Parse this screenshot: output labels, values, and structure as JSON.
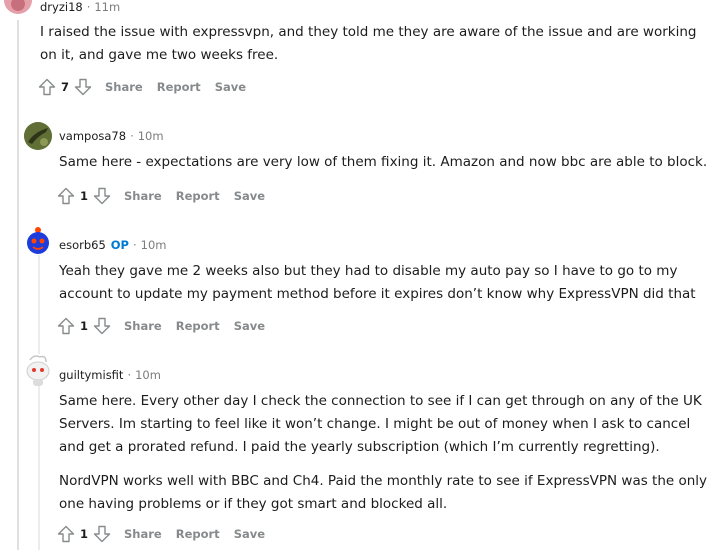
{
  "comments": [
    {
      "username": "dryzi18",
      "time": "11m",
      "body": [
        "I raised the issue with expressvpn, and they told me they are aware of the issue and are working on it, and gave me two weeks free."
      ],
      "score": "7",
      "actions": {
        "share": "Share",
        "report": "Report",
        "save": "Save"
      }
    },
    {
      "username": "vamposa78",
      "time": "10m",
      "body": [
        "Same here - expectations are very low of them fixing it. Amazon and now bbc are able to block."
      ],
      "score": "1",
      "actions": {
        "share": "Share",
        "report": "Report",
        "save": "Save"
      }
    },
    {
      "username": "esorb65",
      "op": "OP",
      "time": "10m",
      "body": [
        "Yeah they gave me 2 weeks also but they had to disable my auto pay so I have to go to my account to update my payment method before it expires don’t know why ExpressVPN did that"
      ],
      "score": "1",
      "actions": {
        "share": "Share",
        "report": "Report",
        "save": "Save"
      }
    },
    {
      "username": "guiltymisfit",
      "time": "10m",
      "body": [
        "Same here. Every other day I check the connection to see if I can get through on any of the UK Servers. Im starting to feel like it won’t change. I might be out of money when I ask to cancel and get a prorated refund. I paid the yearly subscription (which I’m currently regretting).",
        "NordVPN works well with BBC and Ch4. Paid the monthly rate to see if ExpressVPN was the only one having problems or if they got smart and blocked all."
      ],
      "score": "1",
      "actions": {
        "share": "Share",
        "report": "Report",
        "save": "Save"
      }
    }
  ],
  "meta_separator": "·"
}
